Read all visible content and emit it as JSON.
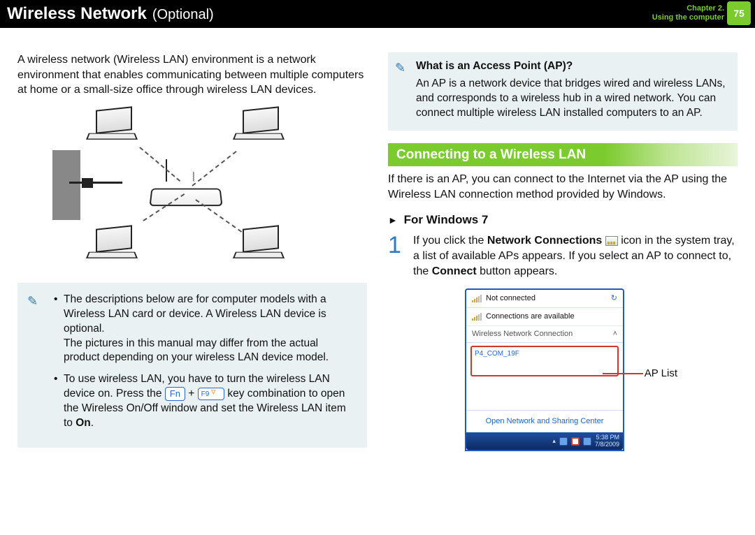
{
  "header": {
    "title_strong": "Wireless Network",
    "title_light": "(Optional)",
    "chapter_line1": "Chapter 2.",
    "chapter_line2": "Using the computer",
    "page_number": "75"
  },
  "left": {
    "intro": "A wireless network (Wireless LAN) environment is a network environment that enables communicating between multiple computers at home or a small-size office through wireless LAN devices.",
    "notes": {
      "bullet1a": "The descriptions below are for computer models with a Wireless LAN card or device. A Wireless LAN device is optional.",
      "bullet1b": "The pictures in this manual may differ from the actual product depending on your wireless LAN device model.",
      "bullet2_pre": "To use wireless LAN, you have to turn the wireless LAN device on. Press the ",
      "key_fn": "Fn",
      "plus": " + ",
      "key_f9": "F9",
      "bullet2_post": " key combination to open the Wireless On/Off window and set the Wireless LAN item to ",
      "on_word": "On",
      "period": "."
    }
  },
  "right": {
    "ap_q": "What is an Access Point (AP)?",
    "ap_a": "An AP is a network device that bridges wired and wireless LANs, and corresponds to a wireless hub in a wired network. You can connect multiple wireless LAN installed computers to an AP.",
    "section": "Connecting to a Wireless LAN",
    "section_p": "If there is an AP, you can connect to the Internet via the AP using the Wireless LAN connection method provided by Windows.",
    "for_windows": "For Windows 7",
    "step1_num": "1",
    "step1_a": "If you click the ",
    "step1_b_bold": "Network Connections",
    "step1_c": " icon in the system tray, a list of available APs appears. If you select an AP to connect to, the ",
    "step1_d_bold": "Connect",
    "step1_e": " button appears.",
    "panel": {
      "not_connected": "Not connected",
      "connections_available": "Connections are available",
      "wnc": "Wireless Network Connection",
      "ap_name": "P4_COM_19F",
      "open_center": "Open Network and Sharing Center",
      "time": "5:38 PM",
      "date": "7/8/2009"
    },
    "ap_list_label": "AP List"
  }
}
